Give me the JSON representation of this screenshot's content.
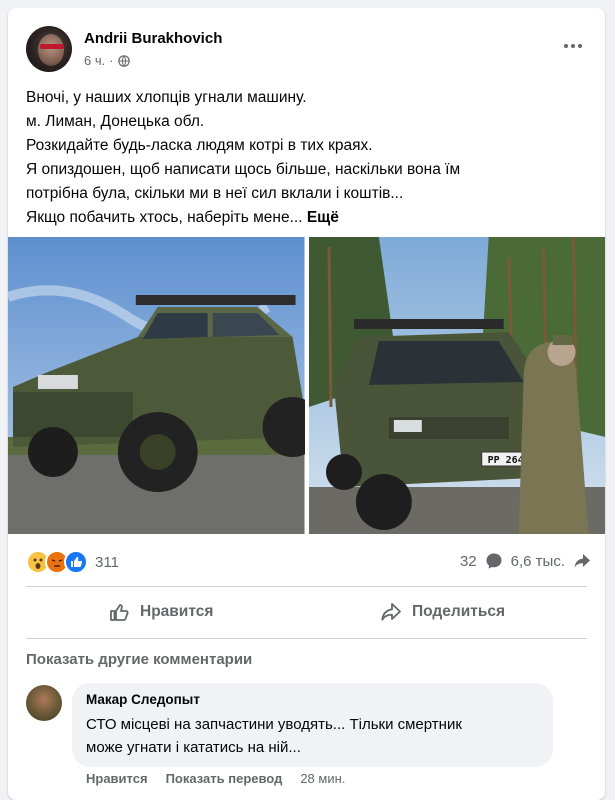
{
  "post": {
    "author": "Andrii Burakhovich",
    "time": "6 ч.",
    "separator": "·",
    "lines": [
      "Вночі, у наших хлопців угнали машину.",
      "м. Лиман, Донецька обл.",
      "Розкидайте будь-ласка людям котрі в тих краях.",
      "Я опиздошен, щоб написати щось більше, наскільки вона їм",
      "потрібна була, скільки ми в неї сил вклали і коштів...",
      "Якщо побачить хтось, наберіть мене..."
    ],
    "see_more": "Ещё"
  },
  "photos": {
    "right_plate": "PP 26415"
  },
  "stats": {
    "reactions_count": "311",
    "comments_count": "32",
    "shares_count": "6,6 тыс."
  },
  "actions": {
    "like": "Нравится",
    "share": "Поделиться"
  },
  "comments": {
    "show_more": "Показать другие комментарии",
    "items": [
      {
        "author": "Макар Следопыт",
        "lines": [
          "СТО місцеві на запчастини уводять... Тільки смертник",
          "може угнати і кататись на ній..."
        ],
        "like": "Нравится",
        "translate": "Показать перевод",
        "time": "28 мин."
      }
    ]
  },
  "icons": [
    "globe-icon",
    "more-icon",
    "wow-icon",
    "angry-icon",
    "like-reaction-icon",
    "comment-icon",
    "share-icon",
    "like-icon"
  ],
  "colors": {
    "accent": "#1877f2",
    "muted": "#65676b",
    "bubble": "#f0f2f5"
  }
}
